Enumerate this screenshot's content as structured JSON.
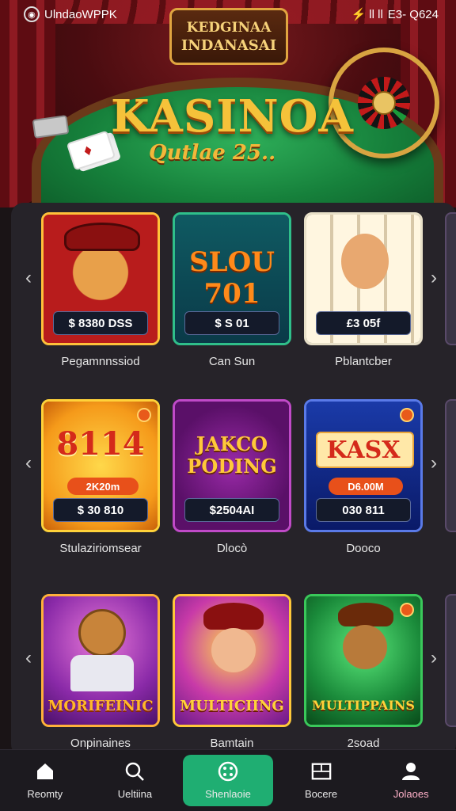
{
  "status_bar": {
    "app_name": "UlndaoWPPK",
    "indicators": "⚡ ll ll",
    "time": "E3- Q624"
  },
  "hero": {
    "sign_line1": "KEDGINAA",
    "sign_line2": "INDANASAI",
    "title": "KASINOA",
    "subtitle": "Qutlae 25.."
  },
  "games": {
    "rows": [
      {
        "tiles": [
          {
            "art_text": "",
            "price": "$ 8380 DSS",
            "label": "Pegamnnssiod"
          },
          {
            "art_text": "SLOU 701",
            "price": "$ S 01",
            "label": "Can Sun"
          },
          {
            "art_text": "",
            "price": "£3 05f",
            "label": "Pblantcber"
          }
        ]
      },
      {
        "tiles": [
          {
            "art_text": "8114",
            "sub_text": "2K20m",
            "price": "$ 30 810",
            "label": "Stulaziriomsear"
          },
          {
            "art_text": "JAKCO PODING",
            "price": "$2504AI",
            "label": "Dlocò"
          },
          {
            "art_text": "KASX",
            "sub_text": "D6.00M",
            "price": "030 811",
            "label": "Dooco"
          }
        ]
      },
      {
        "tiles": [
          {
            "art_text": "MORIFEINIC",
            "price": "",
            "label": "Onpinaines"
          },
          {
            "art_text": "MULTICIING",
            "price": "",
            "label": "Bamtain"
          },
          {
            "art_text": "MULTIPPAINS",
            "price": "",
            "label": "2soad"
          }
        ]
      }
    ]
  },
  "bottom_nav": {
    "items": [
      {
        "label": "Reomty",
        "icon": "home-icon"
      },
      {
        "label": "Ueltiina",
        "icon": "search-icon"
      },
      {
        "label": "Shenlaoie",
        "icon": "target-icon",
        "active": true
      },
      {
        "label": "Bocere",
        "icon": "grid-icon"
      },
      {
        "label": "Jolaoes",
        "icon": "user-icon"
      }
    ]
  },
  "colors": {
    "accent": "#1fae72",
    "panel": "#262329",
    "tile_border": "#ffc13a",
    "title_gold": "#f5c23a"
  }
}
